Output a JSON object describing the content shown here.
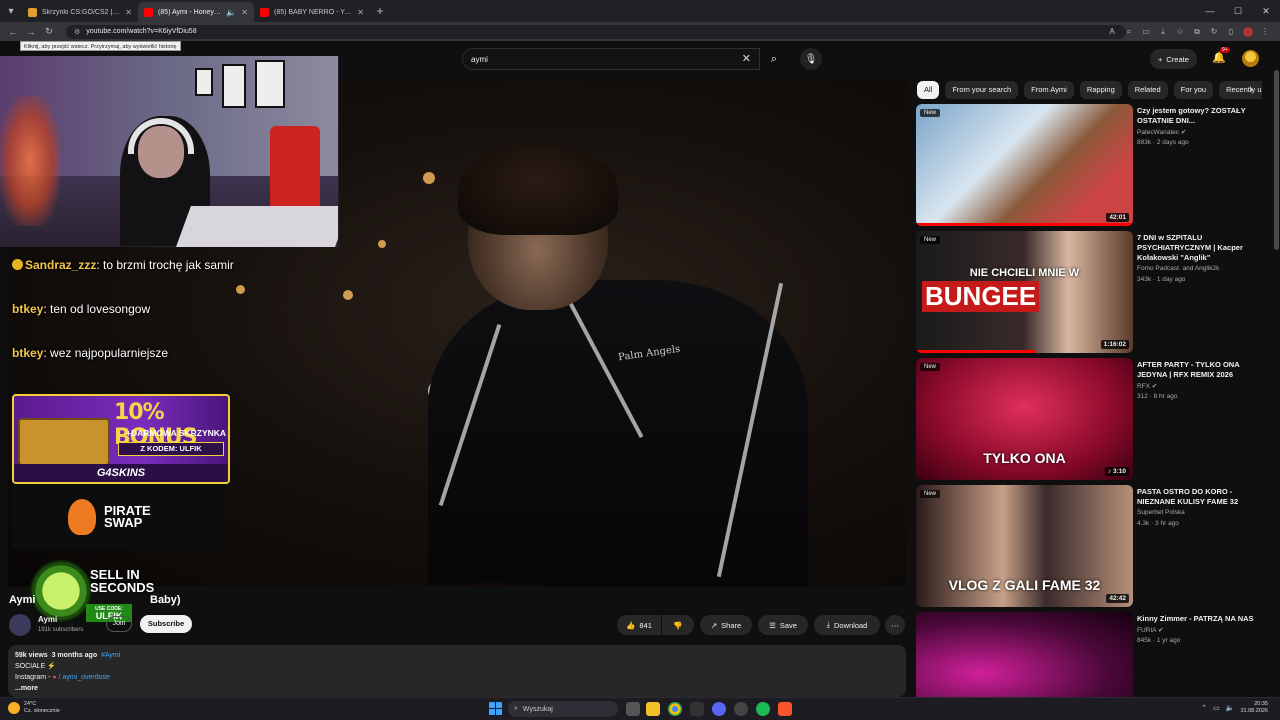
{
  "browser": {
    "tabs": [
      {
        "title": "Skrzynki CS:GO/CS2 | G4Skins",
        "color": "#e0a030"
      },
      {
        "title": "(85) Aymi - Honey Bunny (...",
        "color": "#ff0000",
        "active": true
      },
      {
        "title": "(85) BABY NERRO - YouTube",
        "color": "#ff0000"
      }
    ],
    "new_tab_icon": "+",
    "url": "youtube.com/watch?v=K6iyVfDiu58",
    "tooltip": "Kliknij, aby przejść wstecz. Przytrzymaj, aby wyświetlić historię",
    "nav": {
      "back": "←",
      "forward": "→",
      "reload": "↻"
    },
    "win_controls": {
      "minimize": "—",
      "maximize": "☐",
      "close": "✕"
    }
  },
  "youtube": {
    "search_value": "aymi",
    "clear_icon": "✕",
    "search_icon": "⌕",
    "mic_icon": "🎙",
    "create_label": "Create",
    "create_icon": "+",
    "bell_icon": "🔔",
    "bell_badge": "9+"
  },
  "stream_overlay": {
    "chat": [
      {
        "user": "Sandraz_zzz",
        "message": "to brzmi trochę jak samir",
        "badge": true
      },
      {
        "user": "btkey",
        "message": "ten od lovesongow",
        "badge": false
      },
      {
        "user": "btkey",
        "message": "wez najpopularniejsze",
        "badge": false
      }
    ],
    "ad1": {
      "bonus": "10% BONUS",
      "sub": "+DARMOWA SKRZYNKA",
      "code": "Z KODEM: ULFIK",
      "brand": "G4SKINS"
    },
    "ad2": {
      "name": "PIRATE SWAP"
    },
    "ad3": {
      "line1": "SELL IN",
      "line2": "SECONDS",
      "use_code": "USE CODE:",
      "code": "ULFIK"
    },
    "jacket_text": "Palm Angels"
  },
  "video": {
    "title_start": "Aymi",
    "title_end": "Baby)",
    "channel": "Aymi",
    "subscribers": "191k subscribers",
    "join_label": "Join",
    "subscribe_label": "Subscribe",
    "likes": "841",
    "share_label": "Share",
    "save_label": "Save",
    "download_label": "Download",
    "like_icon": "👍",
    "dislike_icon": "👎",
    "share_icon": "↗",
    "save_icon": "☰",
    "download_icon": "⤓",
    "more_icon": "⋯",
    "views": "59k views",
    "age": "3 months ago",
    "hashtag": "#Aymi",
    "desc_line1": "SOCIALE ⚡",
    "desc_line2_prefix": "Instagram - ",
    "desc_line2_handle": "/ aymi_overdose",
    "more_label": "...more"
  },
  "chips": [
    "All",
    "From your search",
    "From Aymi",
    "Rapping",
    "Related",
    "For you",
    "Recently uploaded"
  ],
  "chip_next_icon": "›",
  "recommendations": [
    {
      "title": "Czy jestem gotowy? ZOSTAŁY OSTATNIE DNI...",
      "channel": "PatecWariatec ✔",
      "meta": "883k · 2 days ago",
      "duration": "42:01",
      "new": "New",
      "progress": 1.0,
      "thumb": "linear-gradient(135deg,#7aa4c8,#d9e6f0 40%,#8a5a3a 60%,#c44 80%)"
    },
    {
      "title": "7 DNI w SZPITALU PSYCHIATRYCZNYM | Kacper Kołakowski \"Anglik\"",
      "channel": "Fomo Padcast. and Anglik2k",
      "meta": "343k · 1 day ago",
      "duration": "1:16:02",
      "new": "New",
      "progress": 0.55,
      "thumb": "linear-gradient(90deg,#1a1a1a,#3a2a2a 50%,#d8b8a0 70%,#5a3a2a)",
      "text": "NIE CHCIELI MNIE W",
      "big": "BUNGEE"
    },
    {
      "title": "AFTER PARTY - TYLKO ONA JEDYNA | RFX REMIX 2026",
      "channel": "RFX ✔",
      "meta": "312 · 8 hr ago",
      "duration": "♪ 3:10",
      "new": "New",
      "progress": 0,
      "thumb": "radial-gradient(ellipse at 50% 40%,#e0305a,#8a0a2a 60%,#3a0010)",
      "text": "TYLKO ONA"
    },
    {
      "title": "PASTA OSTRO DO KORO - NIEZNANE KULISY FAME 32",
      "channel": "Superbet Polska",
      "meta": "4.3k · 3 hr ago",
      "duration": "42:42",
      "new": "New",
      "progress": 0,
      "thumb": "linear-gradient(90deg,#2a1a1a,#c8a088 40%,#3a2a2a 60%,#b8907a)",
      "text": "VLOG Z GALI FAME 32"
    },
    {
      "title": "Kinny Zimmer - PATRZĄ NA NAS",
      "channel": "FURIA ✔",
      "meta": "845k · 1 yr ago",
      "duration": "",
      "new": "",
      "progress": 0,
      "thumb": "radial-gradient(ellipse at 30% 50%,#d0209a,#4a0838 60%,#140010)"
    }
  ],
  "taskbar": {
    "temp": "24°C",
    "weather": "Cz. słonecznie",
    "search_label": "Wyszukaj",
    "time": "20:35",
    "date": "31.08.2026"
  }
}
